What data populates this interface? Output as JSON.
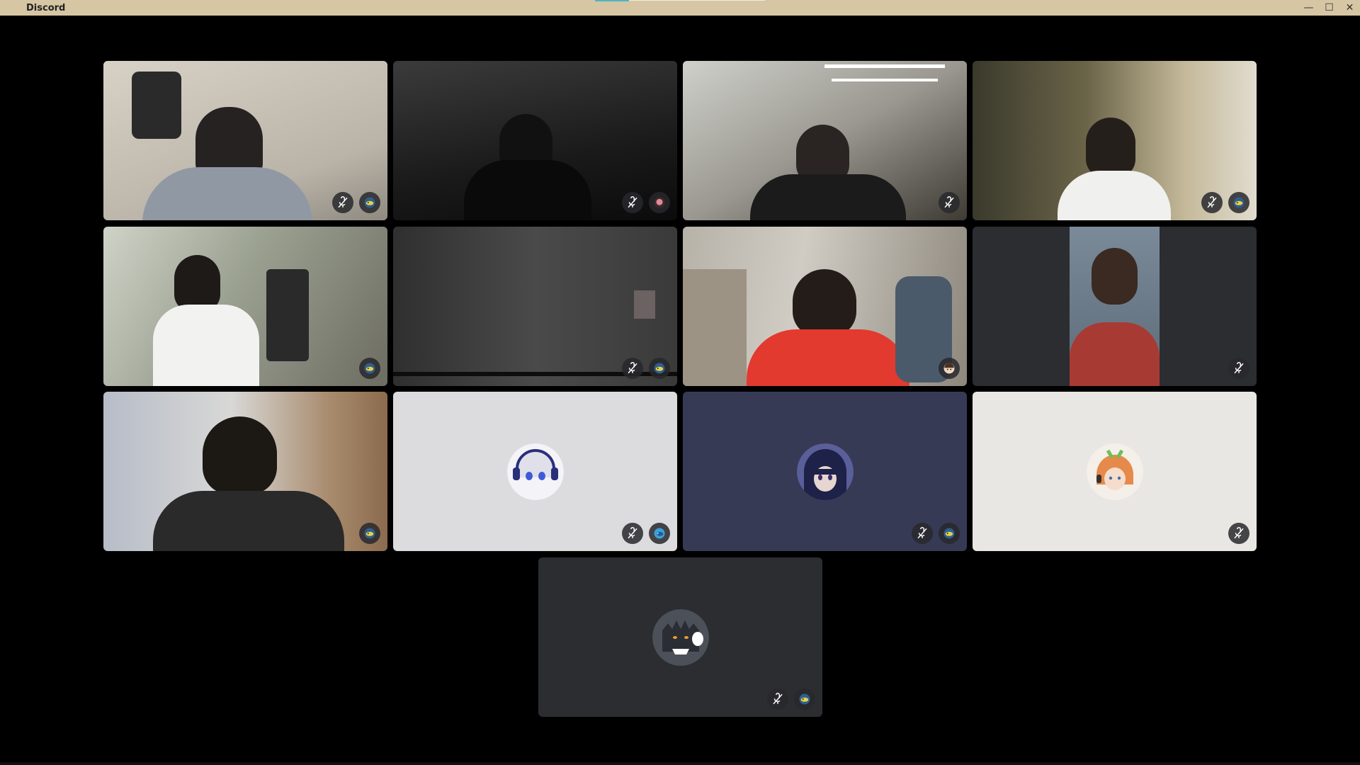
{
  "window": {
    "title": "Discord",
    "minimize": "—",
    "maximize": "☐",
    "close": "✕"
  },
  "tiles": [
    {
      "id": 1,
      "kind": "video",
      "muted": true,
      "status_icon": "fish-avatar-icon"
    },
    {
      "id": 2,
      "kind": "video",
      "muted": true,
      "status_icon": "pink-avatar-icon"
    },
    {
      "id": 3,
      "kind": "video",
      "muted": true,
      "status_icon": ""
    },
    {
      "id": 4,
      "kind": "video",
      "muted": true,
      "status_icon": "fish-avatar-icon"
    },
    {
      "id": 5,
      "kind": "video",
      "muted": false,
      "status_icon": "fish-avatar-icon"
    },
    {
      "id": 6,
      "kind": "video",
      "muted": true,
      "status_icon": "fish-avatar-icon"
    },
    {
      "id": 7,
      "kind": "video",
      "muted": false,
      "status_icon": "anime-avatar-icon"
    },
    {
      "id": 8,
      "kind": "video",
      "muted": true,
      "status_icon": ""
    },
    {
      "id": 9,
      "kind": "video",
      "muted": false,
      "status_icon": "fish-avatar-icon"
    },
    {
      "id": 10,
      "kind": "avatar",
      "muted": true,
      "status_icon": "blue-fish-avatar-icon"
    },
    {
      "id": 11,
      "kind": "avatar",
      "muted": true,
      "status_icon": "fish-avatar-icon"
    },
    {
      "id": 12,
      "kind": "avatar",
      "muted": true,
      "status_icon": ""
    },
    {
      "id": 13,
      "kind": "avatar",
      "muted": true,
      "status_icon": "fish-avatar-icon"
    }
  ],
  "colors": {
    "titlebar": "#d6c6a4",
    "stage": "#000000",
    "tile_dark": "#2b2d31",
    "tile_navy": "#363a55",
    "tile_light": "#dcdcdc"
  }
}
